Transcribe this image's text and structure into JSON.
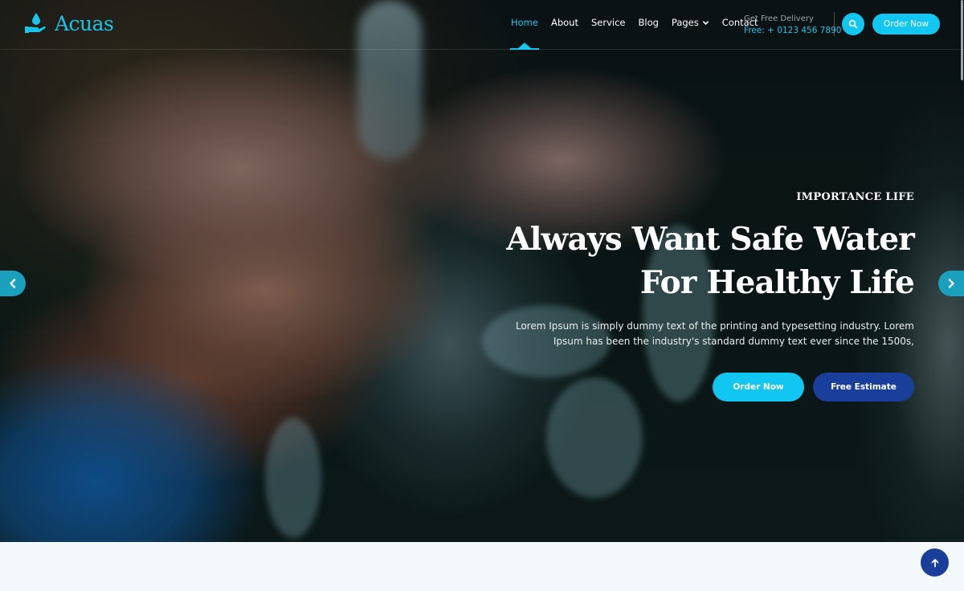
{
  "brand": {
    "name": "Acuas",
    "logo_icon": "water-drop-hand-icon",
    "accent_color": "#11c6f0",
    "secondary_color": "#1a3f9a"
  },
  "nav": {
    "items": [
      {
        "label": "Home",
        "active": true
      },
      {
        "label": "About",
        "active": false
      },
      {
        "label": "Service",
        "active": false
      },
      {
        "label": "Blog",
        "active": false
      },
      {
        "label": "Pages",
        "active": false,
        "has_dropdown": true
      },
      {
        "label": "Contact",
        "active": false
      }
    ]
  },
  "header": {
    "delivery_label": "Get Free Delivery",
    "delivery_phone": "Free: + 0123 456 7890",
    "search_icon": "search-icon",
    "order_button": "Order Now"
  },
  "hero": {
    "eyebrow": "IMPORTANCE LIFE",
    "headline_line1": "Always Want Safe Water",
    "headline_line2": "For Healthy Life",
    "description_line1": "Lorem Ipsum is simply dummy text of the printing and typesetting industry. Lorem",
    "description_line2": "Ipsum has been the industry's standard dummy text ever since the 1500s,",
    "primary_button": "Order Now",
    "secondary_button": "Free Estimate",
    "prev_icon": "chevron-left-icon",
    "next_icon": "chevron-right-icon"
  },
  "back_to_top_icon": "arrow-up-icon"
}
